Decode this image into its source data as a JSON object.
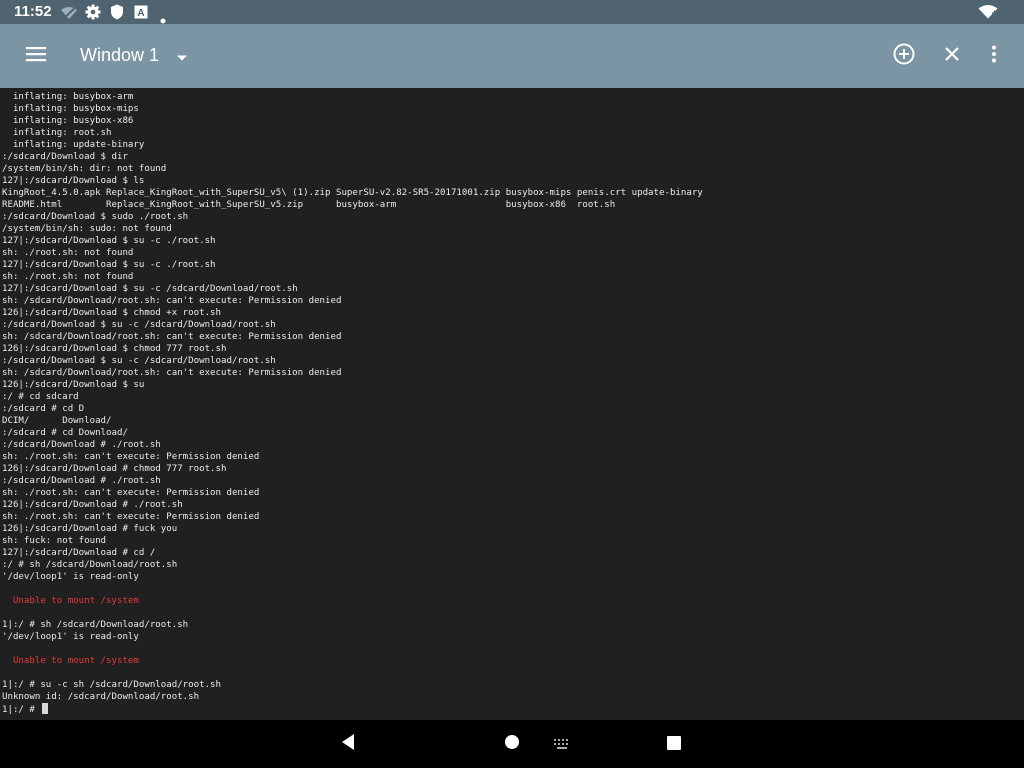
{
  "status_bar": {
    "time": "11:52",
    "icons": [
      "wifi-off-icon",
      "settings-icon",
      "shield-icon",
      "a-app-icon",
      "dot-icon",
      "wifi-icon"
    ]
  },
  "app_bar": {
    "menu_icon": "menu-icon",
    "window_title": "Window 1",
    "dropdown_icon": "chevron-down-icon",
    "add_icon": "add-circle-icon",
    "close_icon": "close-icon",
    "more_icon": "more-vert-icon",
    "background": "#7b95a4"
  },
  "terminal": {
    "background": "#202020",
    "text_color": "#ececec",
    "error_color": "#e53a36",
    "lines": [
      {
        "text": "  inflating: busybox-arm",
        "error": false
      },
      {
        "text": "  inflating: busybox-mips",
        "error": false
      },
      {
        "text": "  inflating: busybox-x86",
        "error": false
      },
      {
        "text": "  inflating: root.sh",
        "error": false
      },
      {
        "text": "  inflating: update-binary",
        "error": false
      },
      {
        "text": ":/sdcard/Download $ dir",
        "error": false
      },
      {
        "text": "/system/bin/sh: dir: not found",
        "error": false
      },
      {
        "text": "127|:/sdcard/Download $ ls",
        "error": false
      },
      {
        "text": "KingRoot_4.5.0.apk Replace_KingRoot_with_SuperSU_v5\\ (1).zip SuperSU-v2.82-SR5-20171001.zip busybox-mips penis.crt update-binary",
        "error": false
      },
      {
        "text": "README.html        Replace_KingRoot_with_SuperSU_v5.zip      busybox-arm                    busybox-x86  root.sh",
        "error": false
      },
      {
        "text": ":/sdcard/Download $ sudo ./root.sh",
        "error": false
      },
      {
        "text": "/system/bin/sh: sudo: not found",
        "error": false
      },
      {
        "text": "127|:/sdcard/Download $ su -c ./root.sh",
        "error": false
      },
      {
        "text": "sh: ./root.sh: not found",
        "error": false
      },
      {
        "text": "127|:/sdcard/Download $ su -c ./root.sh",
        "error": false
      },
      {
        "text": "sh: ./root.sh: not found",
        "error": false
      },
      {
        "text": "127|:/sdcard/Download $ su -c /sdcard/Download/root.sh",
        "error": false
      },
      {
        "text": "sh: /sdcard/Download/root.sh: can't execute: Permission denied",
        "error": false
      },
      {
        "text": "126|:/sdcard/Download $ chmod +x root.sh",
        "error": false
      },
      {
        "text": ":/sdcard/Download $ su -c /sdcard/Download/root.sh",
        "error": false
      },
      {
        "text": "sh: /sdcard/Download/root.sh: can't execute: Permission denied",
        "error": false
      },
      {
        "text": "126|:/sdcard/Download $ chmod 777 root.sh",
        "error": false
      },
      {
        "text": ":/sdcard/Download $ su -c /sdcard/Download/root.sh",
        "error": false
      },
      {
        "text": "sh: /sdcard/Download/root.sh: can't execute: Permission denied",
        "error": false
      },
      {
        "text": "126|:/sdcard/Download $ su",
        "error": false
      },
      {
        "text": ":/ # cd sdcard",
        "error": false
      },
      {
        "text": ":/sdcard # cd D",
        "error": false
      },
      {
        "text": "DCIM/      Download/",
        "error": false
      },
      {
        "text": ":/sdcard # cd Download/",
        "error": false
      },
      {
        "text": ":/sdcard/Download # ./root.sh",
        "error": false
      },
      {
        "text": "sh: ./root.sh: can't execute: Permission denied",
        "error": false
      },
      {
        "text": "126|:/sdcard/Download # chmod 777 root.sh",
        "error": false
      },
      {
        "text": ":/sdcard/Download # ./root.sh",
        "error": false
      },
      {
        "text": "sh: ./root.sh: can't execute: Permission denied",
        "error": false
      },
      {
        "text": "126|:/sdcard/Download # ./root.sh",
        "error": false
      },
      {
        "text": "sh: ./root.sh: can't execute: Permission denied",
        "error": false
      },
      {
        "text": "126|:/sdcard/Download # fuck you",
        "error": false
      },
      {
        "text": "sh: fuck: not found",
        "error": false
      },
      {
        "text": "127|:/sdcard/Download # cd /",
        "error": false
      },
      {
        "text": ":/ # sh /sdcard/Download/root.sh",
        "error": false
      },
      {
        "text": "'/dev/loop1' is read-only",
        "error": false
      },
      {
        "text": "",
        "error": false
      },
      {
        "text": "  Unable to mount /system",
        "error": true
      },
      {
        "text": "",
        "error": false
      },
      {
        "text": "1|:/ # sh /sdcard/Download/root.sh",
        "error": false
      },
      {
        "text": "'/dev/loop1' is read-only",
        "error": false
      },
      {
        "text": "",
        "error": false
      },
      {
        "text": "  Unable to mount /system",
        "error": true
      },
      {
        "text": "",
        "error": false
      },
      {
        "text": "1|:/ # su -c sh /sdcard/Download/root.sh",
        "error": false
      },
      {
        "text": "Unknown id: /sdcard/Download/root.sh",
        "error": false
      }
    ],
    "prompt": "1|:/ # "
  },
  "nav_bar": {
    "icons": [
      "back-icon",
      "home-icon",
      "keyboard-icon",
      "recents-icon"
    ]
  }
}
